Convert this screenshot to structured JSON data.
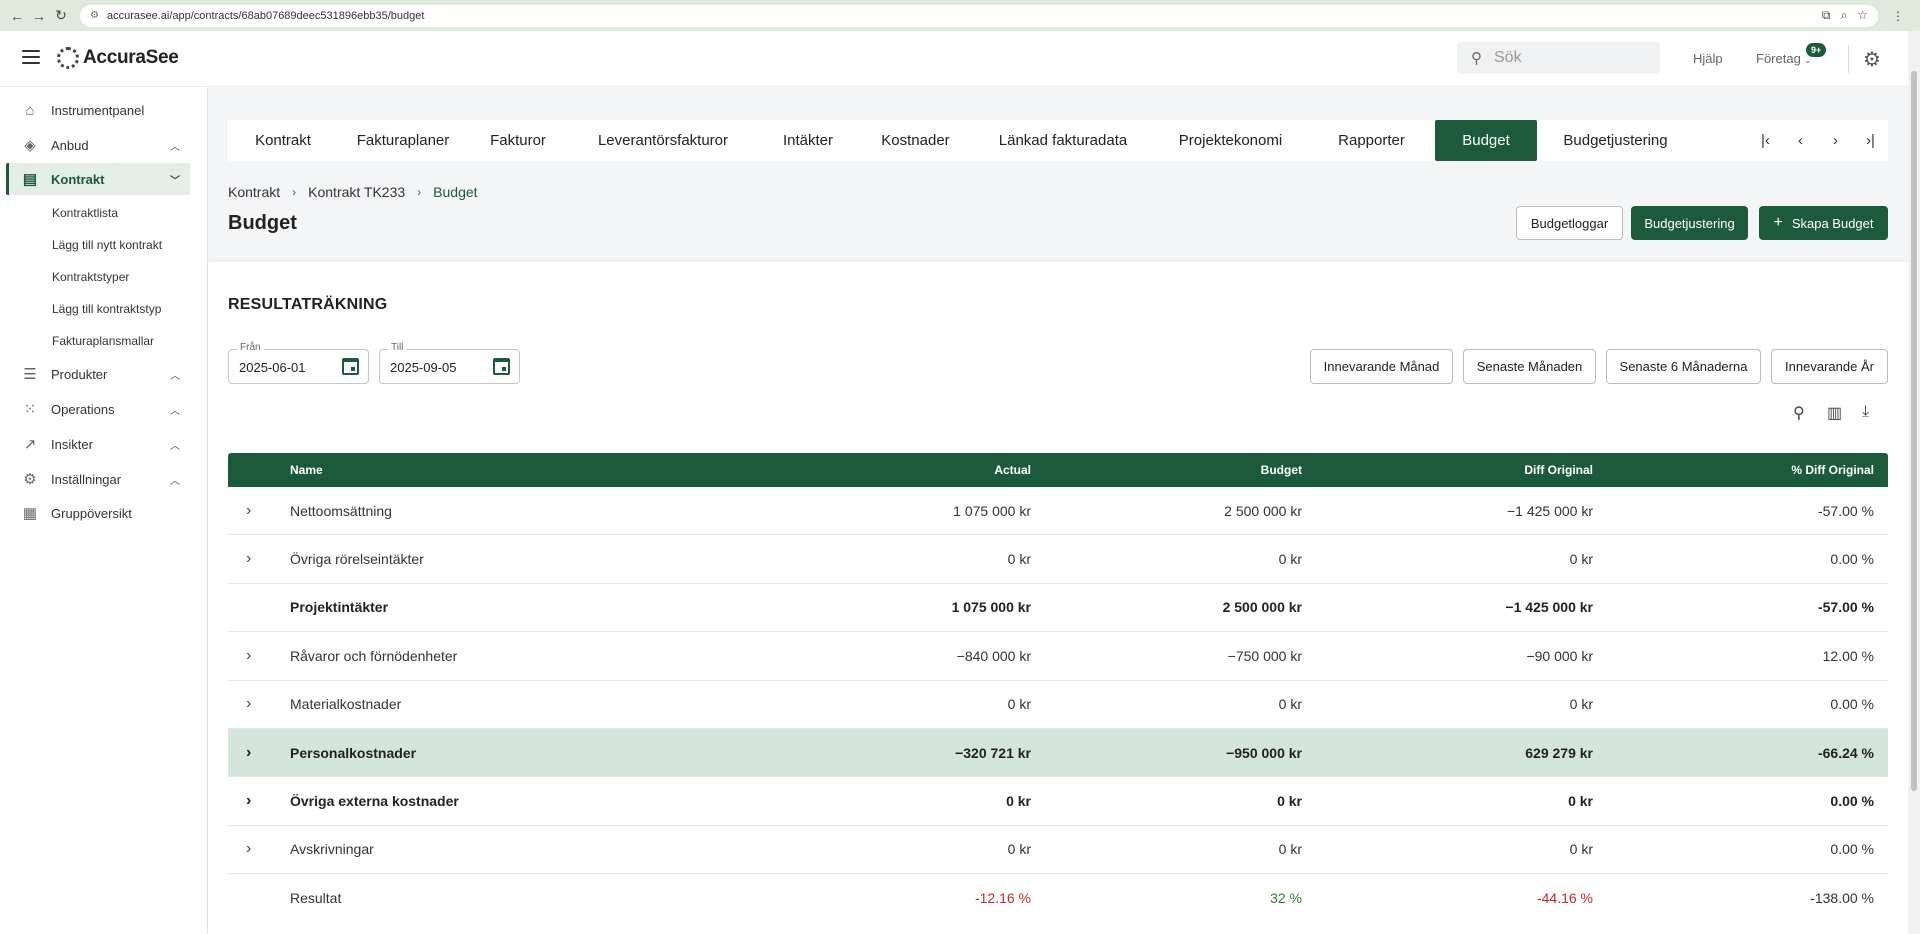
{
  "browser": {
    "url": "accurasee.ai/app/contracts/68ab07689deec531896ebb35/budget"
  },
  "header": {
    "logo_text": "AccuraSee",
    "search_placeholder": "Sök",
    "help_label": "Hjälp",
    "company_label": "Företag",
    "notification_badge": "9+"
  },
  "sidebar": {
    "items": [
      {
        "label": "Instrumentpanel",
        "icon": "home-icon"
      },
      {
        "label": "Anbud",
        "icon": "tag-icon"
      },
      {
        "label": "Kontrakt",
        "icon": "document-icon"
      },
      {
        "label": "Produkter",
        "icon": "list-icon"
      },
      {
        "label": "Operations",
        "icon": "apps-icon"
      },
      {
        "label": "Insikter",
        "icon": "trending-icon"
      },
      {
        "label": "Inställningar",
        "icon": "gear-icon"
      },
      {
        "label": "Gruppöversikt",
        "icon": "clipboard-icon"
      }
    ],
    "kontrakt_subitems": [
      "Kontraktlista",
      "Lägg till nytt kontrakt",
      "Kontraktstyper",
      "Lägg till kontraktstyp",
      "Fakturaplansmallar"
    ]
  },
  "tabs": [
    "Kontrakt",
    "Fakturaplaner",
    "Fakturor",
    "Leverantörsfakturor",
    "Intäkter",
    "Kostnader",
    "Länkad fakturadata",
    "Projektekonomi",
    "Rapporter",
    "Budget",
    "Budgetjustering"
  ],
  "active_tab": "Budget",
  "breadcrumb": [
    "Kontrakt",
    "Kontrakt TK233",
    "Budget"
  ],
  "page_title": "Budget",
  "actions": {
    "logs": "Budgetloggar",
    "adjust": "Budgetjustering",
    "create": "Skapa Budget"
  },
  "section_title": "RESULTATRÄKNING",
  "date_from": {
    "label": "Från",
    "value": "2025-06-01"
  },
  "date_to": {
    "label": "Till",
    "value": "2025-09-05"
  },
  "period_buttons": [
    "Innevarande Månad",
    "Senaste Månaden",
    "Senaste 6 Månaderna",
    "Innevarande År"
  ],
  "table": {
    "columns": [
      "Name",
      "Actual",
      "Budget",
      "Diff Original",
      "% Diff Original"
    ],
    "rows": [
      {
        "name": "Nettoomsättning",
        "actual": "1 075 000 kr",
        "budget": "2 500 000 kr",
        "diff": "−1 425 000 kr",
        "pct": "-57.00 %"
      },
      {
        "name": "Övriga rörelseintäkter",
        "actual": "0 kr",
        "budget": "0 kr",
        "diff": "0 kr",
        "pct": "0.00 %"
      },
      {
        "name": "Projektintäkter",
        "actual": "1 075 000 kr",
        "budget": "2 500 000 kr",
        "diff": "−1 425 000 kr",
        "pct": "-57.00 %"
      },
      {
        "name": "Råvaror och förnödenheter",
        "actual": "−840 000 kr",
        "budget": "−750 000 kr",
        "diff": "−90 000 kr",
        "pct": "12.00 %"
      },
      {
        "name": "Materialkostnader",
        "actual": "0 kr",
        "budget": "0 kr",
        "diff": "0 kr",
        "pct": "0.00 %"
      },
      {
        "name": "Personalkostnader",
        "actual": "−320 721 kr",
        "budget": "−950 000 kr",
        "diff": "629 279 kr",
        "pct": "-66.24 %"
      },
      {
        "name": "Övriga externa kostnader",
        "actual": "0 kr",
        "budget": "0 kr",
        "diff": "0 kr",
        "pct": "0.00 %"
      },
      {
        "name": "Avskrivningar",
        "actual": "0 kr",
        "budget": "0 kr",
        "diff": "0 kr",
        "pct": "0.00 %"
      },
      {
        "name": "Resultat",
        "actual": "-12.16 %",
        "budget": "32 %",
        "diff": "-44.16 %",
        "pct": "-138.00 %"
      }
    ]
  },
  "colors": {
    "brand": "#1b5a3a",
    "highlight_row": "#d4e6db",
    "negative": "#c62828",
    "positive": "#2e7d32"
  }
}
